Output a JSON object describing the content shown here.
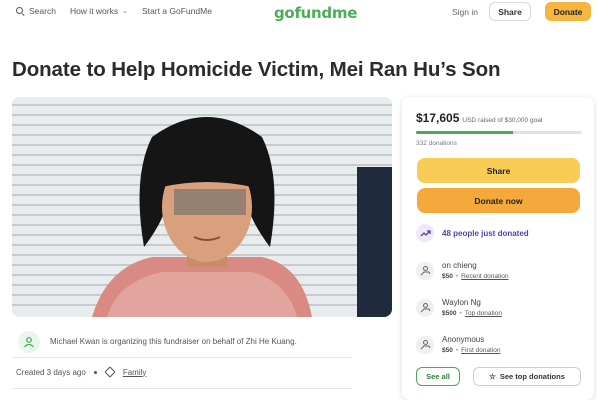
{
  "nav": {
    "search_label": "Search",
    "how_it_works_label": "How it works",
    "start_label": "Start a GoFundMe",
    "logo_text": "gofundme",
    "signin_label": "Sign in",
    "share_label": "Share",
    "donate_label": "Donate"
  },
  "page_title": "Donate to Help Homicide Victim, Mei Ran Hu’s Son",
  "organizer": {
    "text": "Michael Kwan is organizing this fundraiser on behalf of Zhi He Kuang."
  },
  "meta": {
    "created": "Created 3 days ago",
    "category": "Family"
  },
  "card": {
    "amount": "$17,605",
    "goal_text": "USD raised of $30,000 goal",
    "progress_fraction": 0.587,
    "donations_count": "332 donations",
    "share_label": "Share",
    "donate_label": "Donate now",
    "just_donated": "48 people just donated",
    "donors": [
      {
        "name": "on chieng",
        "amount": "$50",
        "note": "Recent donation"
      },
      {
        "name": "Waylon Ng",
        "amount": "$500",
        "note": "Top donation"
      },
      {
        "name": "Anonymous",
        "amount": "$50",
        "note": "First donation"
      }
    ],
    "see_all_label": "See all",
    "see_top_label": "See top donations"
  },
  "colors": {
    "brand_green": "#4cae58",
    "donate_orange": "#f5a93a",
    "share_yellow": "#f7cd55",
    "accent_purple": "#5a3fa8"
  }
}
